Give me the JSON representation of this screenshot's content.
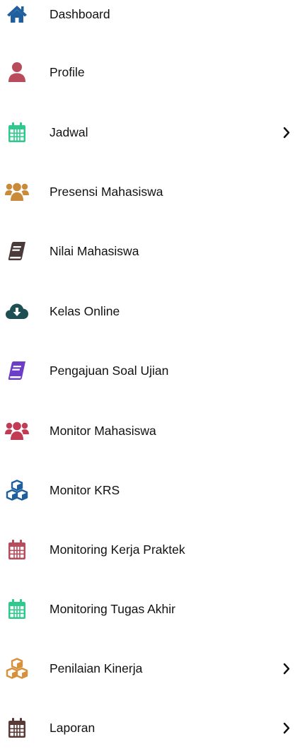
{
  "menu": {
    "items": [
      {
        "label": "Dashboard",
        "icon": "home-icon",
        "color": "#1f5f9e",
        "submenu": false
      },
      {
        "label": "Profile",
        "icon": "user-icon",
        "color": "#b84b5c",
        "submenu": false
      },
      {
        "label": "Jadwal",
        "icon": "calendar-icon",
        "color": "#2ec98c",
        "submenu": true
      },
      {
        "label": "Presensi Mahasiswa",
        "icon": "users-icon",
        "color": "#c98b3b",
        "submenu": false
      },
      {
        "label": "Nilai Mahasiswa",
        "icon": "book-icon",
        "color": "#4b3a3a",
        "submenu": false
      },
      {
        "label": "Kelas Online",
        "icon": "cloud-download-icon",
        "color": "#1e4f52",
        "submenu": false
      },
      {
        "label": "Pengajuan Soal Ujian",
        "icon": "book-icon",
        "color": "#6b3dc9",
        "submenu": false
      },
      {
        "label": "Monitor Mahasiswa",
        "icon": "users-icon",
        "color": "#c23b55",
        "submenu": false
      },
      {
        "label": "Monitor KRS",
        "icon": "cubes-icon",
        "color": "#1f5f9e",
        "submenu": false
      },
      {
        "label": "Monitoring Kerja Praktek",
        "icon": "calendar-icon",
        "color": "#b84b5c",
        "submenu": false
      },
      {
        "label": "Monitoring Tugas Akhir",
        "icon": "calendar-icon",
        "color": "#2ec98c",
        "submenu": false
      },
      {
        "label": "Penilaian Kinerja",
        "icon": "cubes-icon",
        "color": "#d9903a",
        "submenu": true
      },
      {
        "label": "Laporan",
        "icon": "calendar-icon",
        "color": "#5a3a36",
        "submenu": true
      }
    ]
  }
}
